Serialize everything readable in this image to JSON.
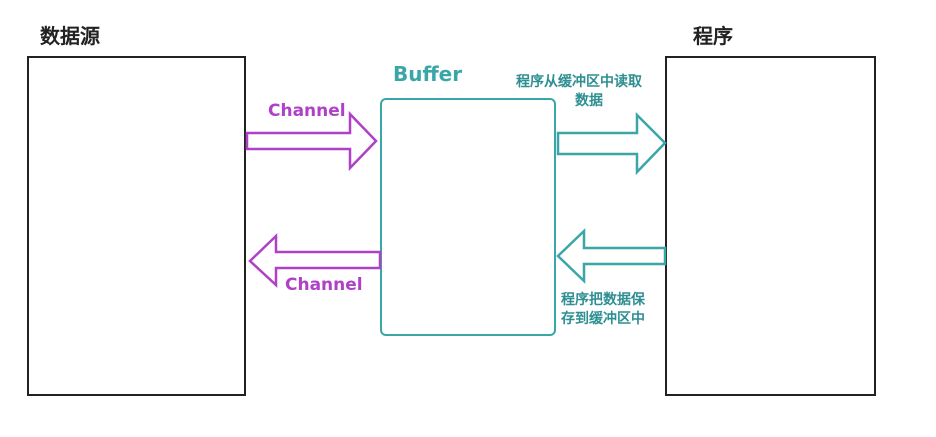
{
  "source": {
    "title": "数据源"
  },
  "program": {
    "title": "程序"
  },
  "buffer": {
    "title": "Buffer"
  },
  "channel_in": {
    "label": "Channel"
  },
  "channel_out": {
    "label": "Channel"
  },
  "read": {
    "line1": "程序从缓冲区中读取",
    "line2": "数据"
  },
  "write": {
    "line1": "程序把数据保",
    "line2": "存到缓冲区中"
  },
  "colors": {
    "channel": "#b040c8",
    "buffer": "#3aa6a8",
    "box_border": "#222222"
  }
}
